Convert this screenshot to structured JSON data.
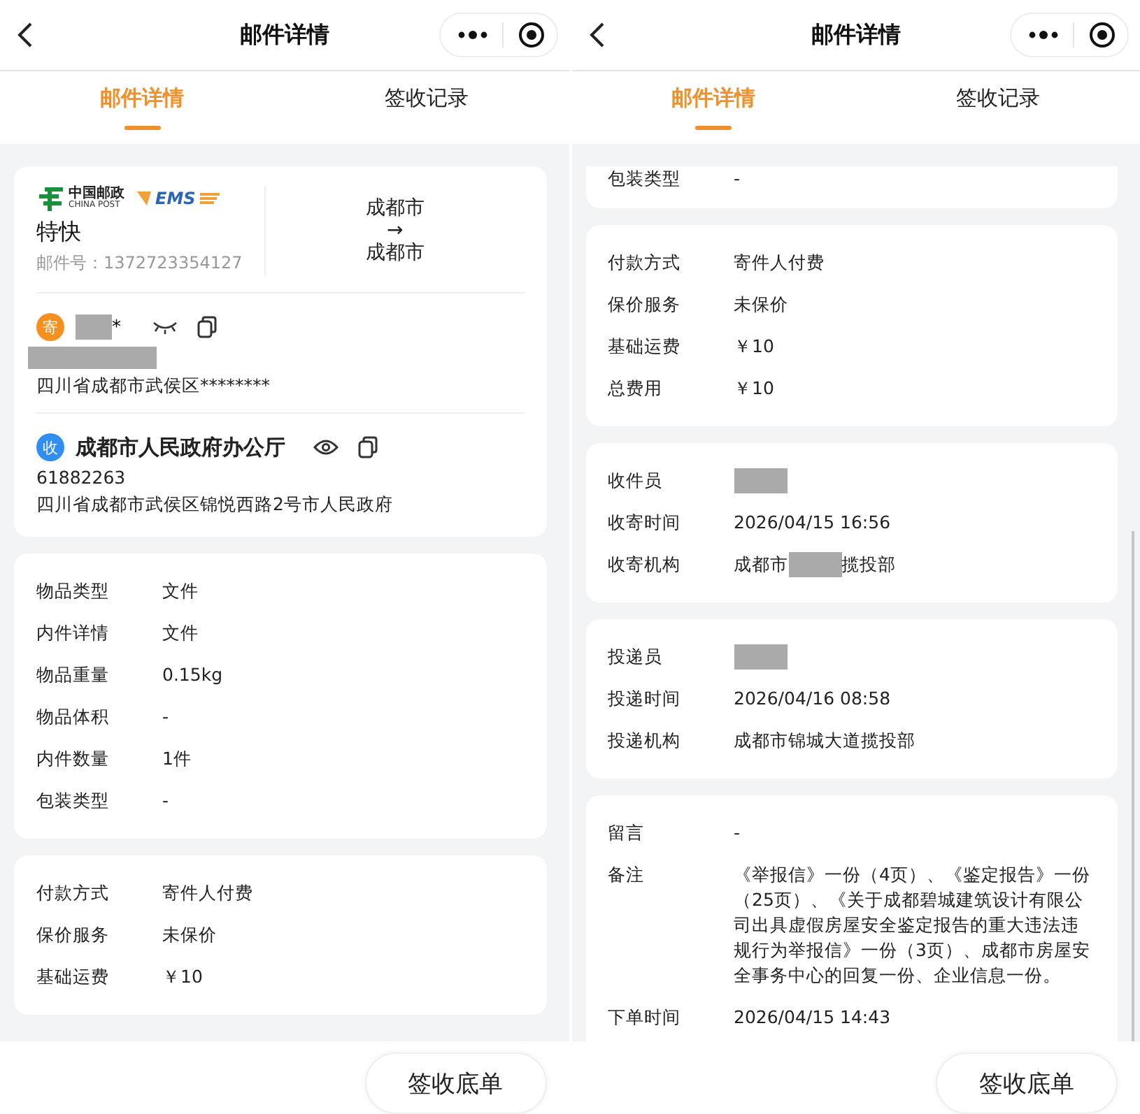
{
  "screens": [
    {
      "title": "邮件详情",
      "tabs": [
        {
          "label": "邮件详情",
          "selected": true
        },
        {
          "label": "签收记录",
          "selected": false
        }
      ],
      "footer_button": "签收底单",
      "cards": [
        {
          "kind": "shipment",
          "carrier": {
            "name_cn": "中国邮政",
            "name_en": "CHINA POST",
            "ems": "EMS"
          },
          "service": "特快",
          "tracking_label": "邮件号：",
          "tracking": "1372723354127",
          "origin": "成都市",
          "arrow": "→",
          "destination": "成都市",
          "contacts": [
            {
              "badge": "寄",
              "color": "#f5901e",
              "name_redacted": true,
              "name_suffix": "*",
              "visible": false,
              "phone_redacted": true,
              "address": "四川省成都市武侯区********"
            },
            {
              "badge": "收",
              "color": "#2f8ef0",
              "name_redacted": false,
              "name": "成都市人民政府办公厅",
              "visible": true,
              "phone_redacted": false,
              "phone": "61882263",
              "address": "四川省成都市武侯区锦悦西路2号市人民政府"
            }
          ]
        },
        {
          "kind": "rows",
          "cut_top": false,
          "rows": [
            {
              "kind": "text",
              "label": "物品类型",
              "value": "文件"
            },
            {
              "kind": "text",
              "label": "内件详情",
              "value": "文件"
            },
            {
              "kind": "text",
              "label": "物品重量",
              "value": "0.15kg"
            },
            {
              "kind": "text",
              "label": "物品体积",
              "value": "-"
            },
            {
              "kind": "text",
              "label": "内件数量",
              "value": "1件"
            },
            {
              "kind": "text",
              "label": "包装类型",
              "value": "-"
            }
          ]
        },
        {
          "kind": "rows",
          "cut_top": false,
          "rows": [
            {
              "kind": "text",
              "label": "付款方式",
              "value": "寄件人付费"
            },
            {
              "kind": "text",
              "label": "保价服务",
              "value": "未保价"
            },
            {
              "kind": "text",
              "label": "基础运费",
              "value": "￥10"
            }
          ]
        }
      ]
    },
    {
      "title": "邮件详情",
      "tabs": [
        {
          "label": "邮件详情",
          "selected": true
        },
        {
          "label": "签收记录",
          "selected": false
        }
      ],
      "scrollbar": true,
      "footer_button": "签收底单",
      "cards": [
        {
          "kind": "rows",
          "cut_top": true,
          "rows": [
            {
              "kind": "text",
              "label": "包装类型",
              "value": "-"
            }
          ]
        },
        {
          "kind": "rows",
          "cut_top": false,
          "rows": [
            {
              "kind": "text",
              "label": "付款方式",
              "value": "寄件人付费"
            },
            {
              "kind": "text",
              "label": "保价服务",
              "value": "未保价"
            },
            {
              "kind": "text",
              "label": "基础运费",
              "value": "￥10"
            },
            {
              "kind": "text",
              "label": "总费用",
              "value": "￥10"
            }
          ]
        },
        {
          "kind": "rows",
          "cut_top": false,
          "rows": [
            {
              "kind": "redacted",
              "label": "收件员"
            },
            {
              "kind": "text",
              "label": "收寄时间",
              "value": "2026/04/15 16:56"
            },
            {
              "kind": "masked",
              "label": "收寄机构",
              "prefix": "成都市",
              "suffix": "揽投部"
            }
          ]
        },
        {
          "kind": "rows",
          "cut_top": false,
          "rows": [
            {
              "kind": "redacted",
              "label": "投递员"
            },
            {
              "kind": "text",
              "label": "投递时间",
              "value": "2026/04/16 08:58"
            },
            {
              "kind": "text",
              "label": "投递机构",
              "value": "成都市锦城大道揽投部"
            }
          ]
        },
        {
          "kind": "rows",
          "cut_top": false,
          "rows": [
            {
              "kind": "text",
              "label": "留言",
              "value": "-"
            },
            {
              "kind": "text",
              "label": "备注",
              "value": "《举报信》一份（4页）、《鉴定报告》一份（25页）、《关于成都碧城建筑设计有限公司出具虚假房屋安全鉴定报告的重大违法违规行为举报信》一份（3页）、成都市房屋安全事务中心的回复一份、企业信息一份。"
            },
            {
              "kind": "text",
              "label": "下单时间",
              "value": "2026/04/15 14:43"
            }
          ]
        }
      ]
    }
  ]
}
